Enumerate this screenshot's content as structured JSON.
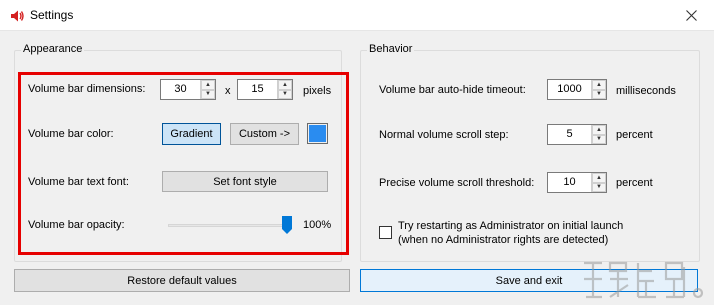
{
  "window": {
    "title": "Settings"
  },
  "appearance": {
    "legend": "Appearance",
    "dimensions": {
      "label": "Volume bar dimensions:",
      "width": "30",
      "separator": "x",
      "height": "15",
      "unit": "pixels"
    },
    "color": {
      "label": "Volume bar color:",
      "gradient_label": "Gradient",
      "custom_label": "Custom ->",
      "swatch_color": "#2a8cf0"
    },
    "font": {
      "label": "Volume bar text font:",
      "button_label": "Set font style"
    },
    "opacity": {
      "label": "Volume bar opacity:",
      "value_text": "100%",
      "level": 1.0
    }
  },
  "behavior": {
    "legend": "Behavior",
    "autohide": {
      "label": "Volume bar auto-hide timeout:",
      "value": "1000",
      "unit": "milliseconds"
    },
    "normal_step": {
      "label": "Normal volume scroll step:",
      "value": "5",
      "unit": "percent"
    },
    "precise_threshold": {
      "label": "Precise volume scroll threshold:",
      "value": "10",
      "unit": "percent"
    },
    "admin": {
      "line1": "Try restarting as Administrator on initial launch",
      "line2": "(when no Administrator rights are detected)",
      "checked": false
    }
  },
  "footer": {
    "restore_label": "Restore default values",
    "save_label": "Save and exit"
  },
  "colors": {
    "highlight": "#e60000",
    "accent": "#0078d7",
    "speaker_icon": "#d42020"
  }
}
